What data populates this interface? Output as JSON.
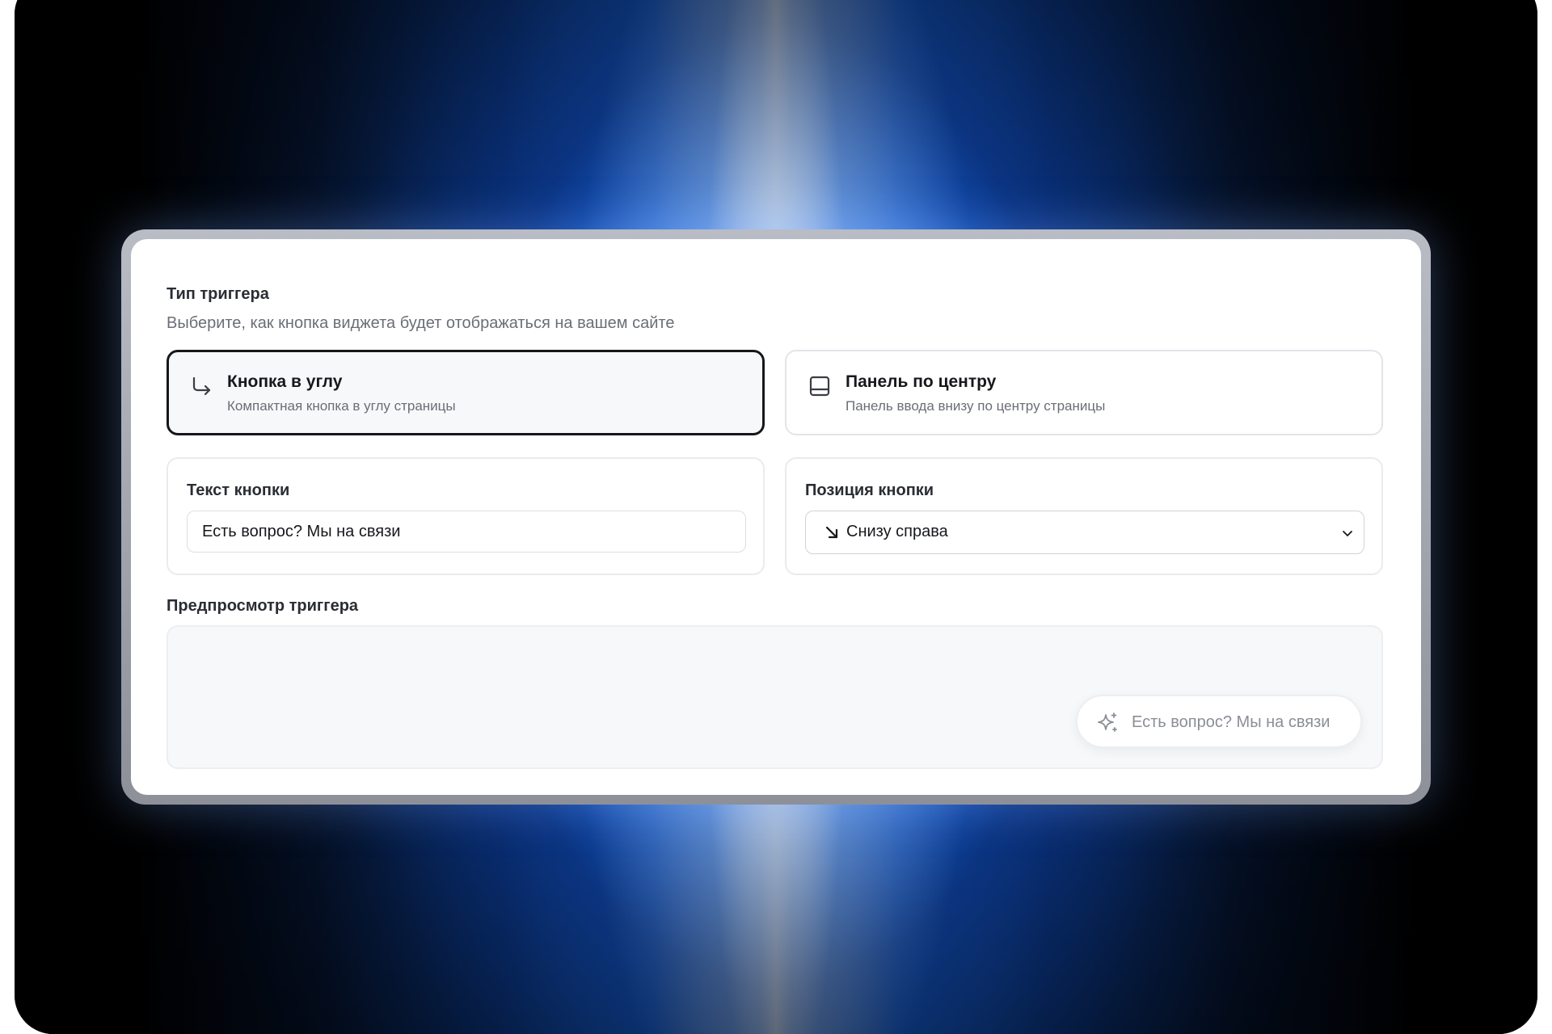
{
  "trigger_type": {
    "title": "Тип триггера",
    "subtitle": "Выберите, как кнопка виджета будет отображаться на вашем сайте",
    "options": [
      {
        "title": "Кнопка в углу",
        "description": "Компактная кнопка в углу страницы",
        "icon": "corner-down-right-icon",
        "selected": true
      },
      {
        "title": "Панель по центру",
        "description": "Панель ввода внизу по центру страницы",
        "icon": "panel-bottom-icon",
        "selected": false
      }
    ]
  },
  "button_text": {
    "label": "Текст кнопки",
    "value": "Есть вопрос? Мы на связи"
  },
  "button_position": {
    "label": "Позиция кнопки",
    "selected_icon": "arrow-down-right-icon",
    "selected": "Снизу справа"
  },
  "preview": {
    "label": "Предпросмотр триггера",
    "trigger_text": "Есть вопрос? Мы на связи",
    "trigger_icon": "sparkle-icon"
  }
}
